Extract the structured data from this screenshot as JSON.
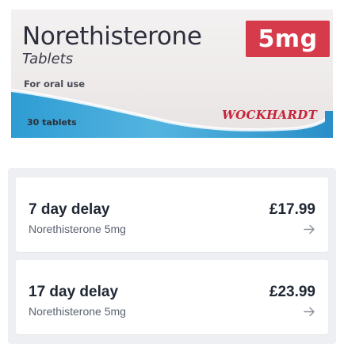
{
  "product_image": {
    "name": "Norethisterone",
    "form": "Tablets",
    "strength": "5mg",
    "usage": "For oral use",
    "count": "30 tablets",
    "brand": "WOCKHARDT"
  },
  "options": [
    {
      "title": "7 day delay",
      "subtitle": "Norethisterone 5mg",
      "price": "£17.99"
    },
    {
      "title": "17 day delay",
      "subtitle": "Norethisterone 5mg",
      "price": "£23.99"
    }
  ],
  "colors": {
    "strength_badge": "#d63b4b",
    "brand": "#c8233a",
    "band_blue": "#3aa3d6",
    "panel_bg": "#edeff2",
    "text_dark": "#1f2733",
    "text_muted": "#5b6270"
  },
  "icons": {
    "option_arrow": "arrow-right-icon"
  }
}
